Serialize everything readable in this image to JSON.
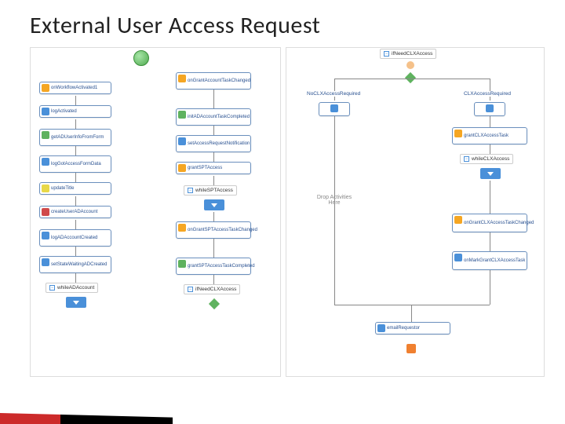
{
  "title": "External User Access Request",
  "col1": {
    "n1": "onWorkflowActivated1",
    "n2": "logActivated",
    "n3": "getADUserInfoFromForm",
    "n4": "logGotAccessFormData",
    "n5": "updateTitle",
    "n6": "createUserADAccount",
    "n7": "logADAccountCreated",
    "n8": "setStateWaitingADCreated",
    "while": "whileADAccount"
  },
  "col2": {
    "n1": "onGrantAccountTaskChanged",
    "n2": "initADAccountTaskCompleted",
    "n3": "setAccessRequestNotification",
    "n4": "grantSPTAccess",
    "while": "whileSPTAccess",
    "n5": "onGrantSPTAccessTaskChanged",
    "n6": "grantSPTAccessTaskCompleted",
    "if": "ifNeedCLXAccess"
  },
  "col3": {
    "ifNode": "ifNeedCLXAccess",
    "branchLeft": "NoCLXAccessRequired",
    "branchRight": "CLXAccessRequired",
    "n1": "grantCLXAccessTask",
    "while": "whileCLXAccess",
    "n2": "onGrantCLXAccessTaskChanged",
    "n3": "onMarkGrantCLXAccessTask",
    "n4": "emailRequestor",
    "dropHint": "Drop Activities Here"
  }
}
